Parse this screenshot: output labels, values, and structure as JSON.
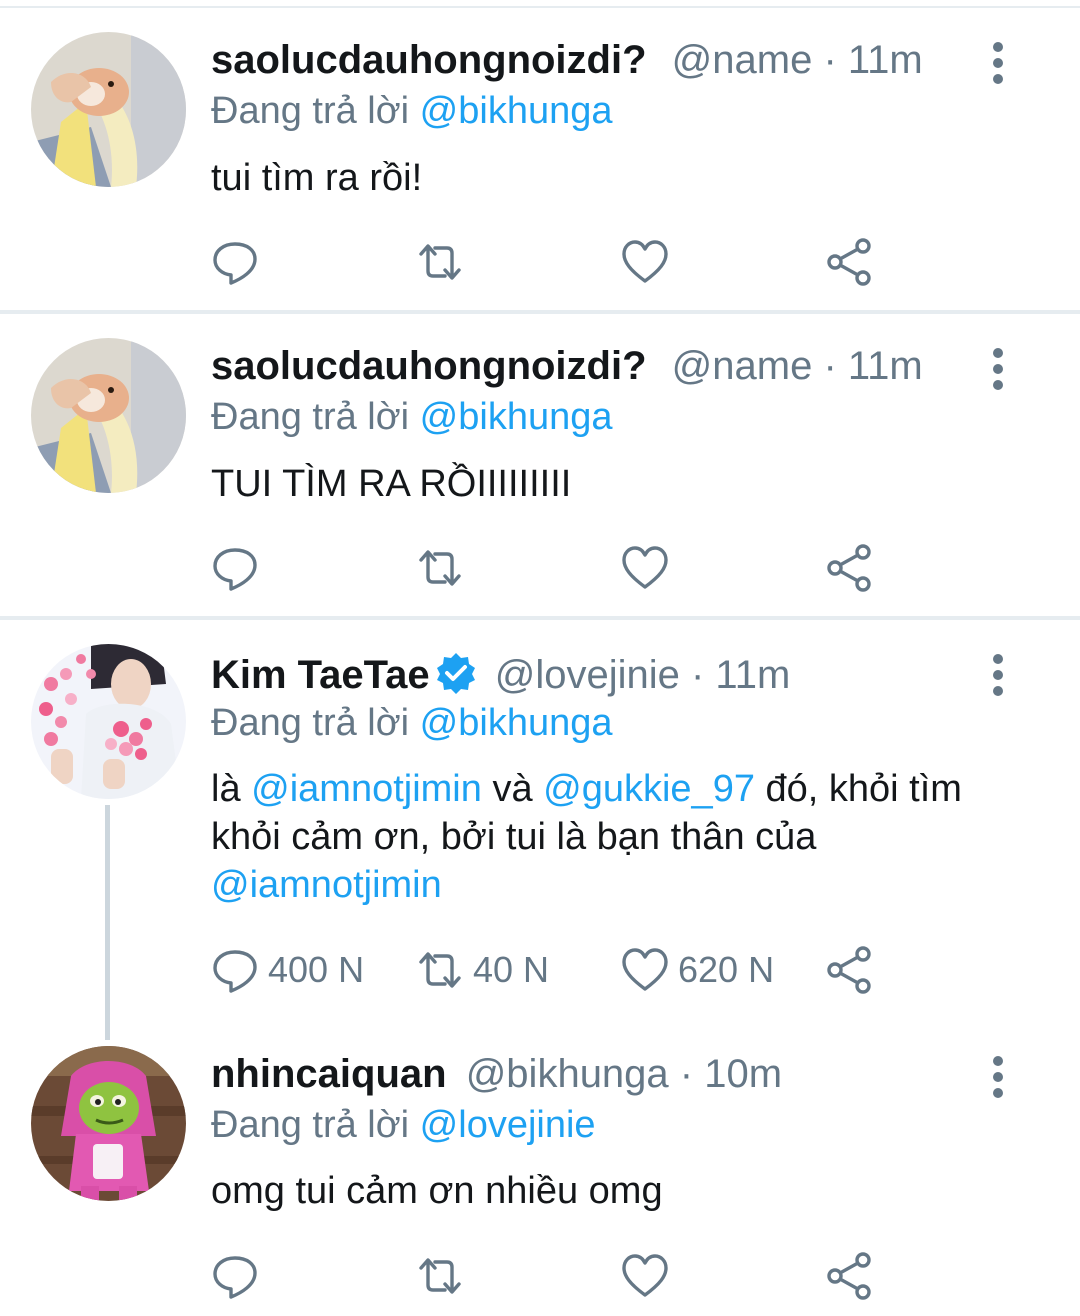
{
  "tweets": [
    {
      "display_name": "saolucdauhongnoizdi?",
      "handle": "@name",
      "separator": "·",
      "time": "11m",
      "replying_prefix": "Đang trả lời",
      "replying_to": "@bikhunga",
      "body": "tui tìm ra rồi!",
      "avatar": "hamster-banana-avatar"
    },
    {
      "display_name": "saolucdauhongnoizdi?",
      "handle": "@name",
      "separator": "·",
      "time": "11m",
      "replying_prefix": "Đang trả lời",
      "replying_to": "@bikhunga",
      "body": "TUI TÌM RA RỒIIIIIIIII",
      "avatar": "hamster-banana-avatar"
    },
    {
      "display_name": "Kim TaeTae",
      "verified": true,
      "handle": "@lovejinie",
      "separator": "·",
      "time": "11m",
      "replying_prefix": "Đang trả lời",
      "replying_to": "@bikhunga",
      "body_parts": [
        "là ",
        "@iamnotjimin",
        " và ",
        "@gukkie_97",
        " đó, khỏi tìm khỏi cảm ơn, bởi tui là bạn thân của ",
        "@iamnotjimin"
      ],
      "replies_count": "400 N",
      "retweets_count": "40 N",
      "likes_count": "620 N",
      "avatar": "person-hearts-avatar"
    },
    {
      "display_name": "nhincaiquan",
      "handle": "@bikhunga",
      "separator": "·",
      "time": "10m",
      "replying_prefix": "Đang trả lời",
      "replying_to": "@lovejinie",
      "body": "omg tui cảm ơn nhiều omg",
      "avatar": "green-frog-pink-hood-avatar"
    }
  ],
  "colors": {
    "link": "#1da1f2",
    "secondary_text": "#657786",
    "primary_text": "#14171a",
    "divider": "#e6ecf0",
    "verified": "#1da1f2"
  },
  "icons": [
    "reply-icon",
    "retweet-icon",
    "like-icon",
    "share-icon",
    "more-options-icon",
    "verified-badge-icon"
  ]
}
